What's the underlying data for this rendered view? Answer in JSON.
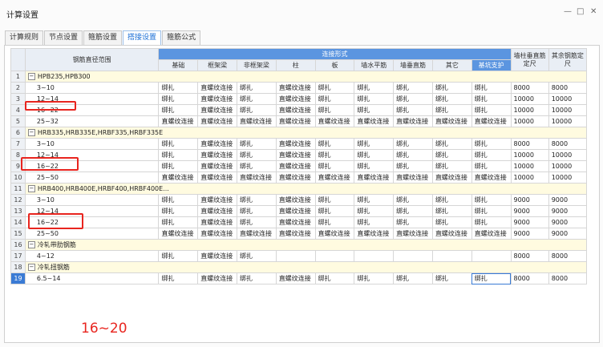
{
  "window": {
    "title": "计算设置",
    "minimize": "—",
    "maximize": "□",
    "close": "✕"
  },
  "tabs": [
    "计算规则",
    "节点设置",
    "箍筋设置",
    "搭接设置",
    "箍筋公式"
  ],
  "active_tab": 3,
  "headers": {
    "diameter": "钢筋直径范围",
    "connection_group": "连接形式",
    "cols": [
      "基础",
      "框架梁",
      "非框架梁",
      "柱",
      "板",
      "墙水平筋",
      "墙垂直筋",
      "其它",
      "基坑支护"
    ],
    "wall_column_fixed": "墙柱垂直筋定尺",
    "other_fixed": "其余钢筋定尺"
  },
  "rows": [
    {
      "n": "1",
      "group": true,
      "label": "HPB235,HPB300"
    },
    {
      "n": "2",
      "label": "3~10",
      "cells": [
        "绑扎",
        "直螺纹连接",
        "绑扎",
        "直螺纹连接",
        "绑扎",
        "绑扎",
        "绑扎",
        "绑扎",
        "绑扎",
        "8000",
        "8000"
      ]
    },
    {
      "n": "3",
      "label": "12~14",
      "cells": [
        "绑扎",
        "直螺纹连接",
        "绑扎",
        "直螺纹连接",
        "绑扎",
        "绑扎",
        "绑扎",
        "绑扎",
        "绑扎",
        "10000",
        "10000"
      ]
    },
    {
      "n": "4",
      "label": "16~22",
      "cells": [
        "绑扎",
        "直螺纹连接",
        "绑扎",
        "直螺纹连接",
        "绑扎",
        "绑扎",
        "绑扎",
        "绑扎",
        "绑扎",
        "10000",
        "10000"
      ]
    },
    {
      "n": "5",
      "label": "25~32",
      "cells": [
        "直螺纹连接",
        "直螺纹连接",
        "直螺纹连接",
        "直螺纹连接",
        "直螺纹连接",
        "直螺纹连接",
        "直螺纹连接",
        "直螺纹连接",
        "直螺纹连接",
        "10000",
        "10000"
      ]
    },
    {
      "n": "6",
      "group": true,
      "label": "HRB335,HRB335E,HRBF335,HRBF335E"
    },
    {
      "n": "7",
      "label": "3~10",
      "cells": [
        "绑扎",
        "直螺纹连接",
        "绑扎",
        "直螺纹连接",
        "绑扎",
        "绑扎",
        "绑扎",
        "绑扎",
        "绑扎",
        "8000",
        "8000"
      ]
    },
    {
      "n": "8",
      "label": "12~14",
      "cells": [
        "绑扎",
        "直螺纹连接",
        "绑扎",
        "直螺纹连接",
        "绑扎",
        "绑扎",
        "绑扎",
        "绑扎",
        "绑扎",
        "10000",
        "10000"
      ]
    },
    {
      "n": "9",
      "label": "16~22",
      "cells": [
        "绑扎",
        "直螺纹连接",
        "绑扎",
        "直螺纹连接",
        "绑扎",
        "绑扎",
        "绑扎",
        "绑扎",
        "绑扎",
        "10000",
        "10000"
      ]
    },
    {
      "n": "10",
      "label": "25~50",
      "cells": [
        "直螺纹连接",
        "直螺纹连接",
        "直螺纹连接",
        "直螺纹连接",
        "直螺纹连接",
        "直螺纹连接",
        "直螺纹连接",
        "直螺纹连接",
        "直螺纹连接",
        "10000",
        "10000"
      ]
    },
    {
      "n": "11",
      "group": true,
      "label": "HRB400,HRB400E,HRBF400,HRBF400E..."
    },
    {
      "n": "12",
      "label": "3~10",
      "cells": [
        "绑扎",
        "直螺纹连接",
        "绑扎",
        "直螺纹连接",
        "绑扎",
        "绑扎",
        "绑扎",
        "绑扎",
        "绑扎",
        "9000",
        "9000"
      ]
    },
    {
      "n": "13",
      "label": "12~14",
      "cells": [
        "绑扎",
        "直螺纹连接",
        "绑扎",
        "直螺纹连接",
        "绑扎",
        "绑扎",
        "绑扎",
        "绑扎",
        "绑扎",
        "9000",
        "9000"
      ]
    },
    {
      "n": "14",
      "label": "16~22",
      "cells": [
        "绑扎",
        "直螺纹连接",
        "绑扎",
        "直螺纹连接",
        "绑扎",
        "绑扎",
        "绑扎",
        "绑扎",
        "绑扎",
        "9000",
        "9000"
      ]
    },
    {
      "n": "15",
      "label": "25~50",
      "cells": [
        "直螺纹连接",
        "直螺纹连接",
        "直螺纹连接",
        "直螺纹连接",
        "直螺纹连接",
        "直螺纹连接",
        "直螺纹连接",
        "直螺纹连接",
        "直螺纹连接",
        "9000",
        "9000"
      ]
    },
    {
      "n": "16",
      "group": true,
      "label": "冷轧带肋钢筋"
    },
    {
      "n": "17",
      "label": "4~12",
      "cells": [
        "绑扎",
        "直螺纹连接",
        "绑扎",
        "",
        "",
        "",
        "",
        "",
        "",
        "8000",
        "8000"
      ]
    },
    {
      "n": "18",
      "group": true,
      "label": "冷轧扭钢筋"
    },
    {
      "n": "19",
      "label": "6.5~14",
      "selected": true,
      "cells": [
        "绑扎",
        "直螺纹连接",
        "绑扎",
        "直螺纹连接",
        "绑扎",
        "绑扎",
        "绑扎",
        "绑扎",
        "绑扎",
        "8000",
        "8000"
      ]
    }
  ],
  "annotation_text": "16~20",
  "colors": {
    "accent": "#3a7bd5",
    "header_blue": "#5b95e0",
    "group_row": "#fffbe0",
    "annotation_red": "#e8251f"
  }
}
